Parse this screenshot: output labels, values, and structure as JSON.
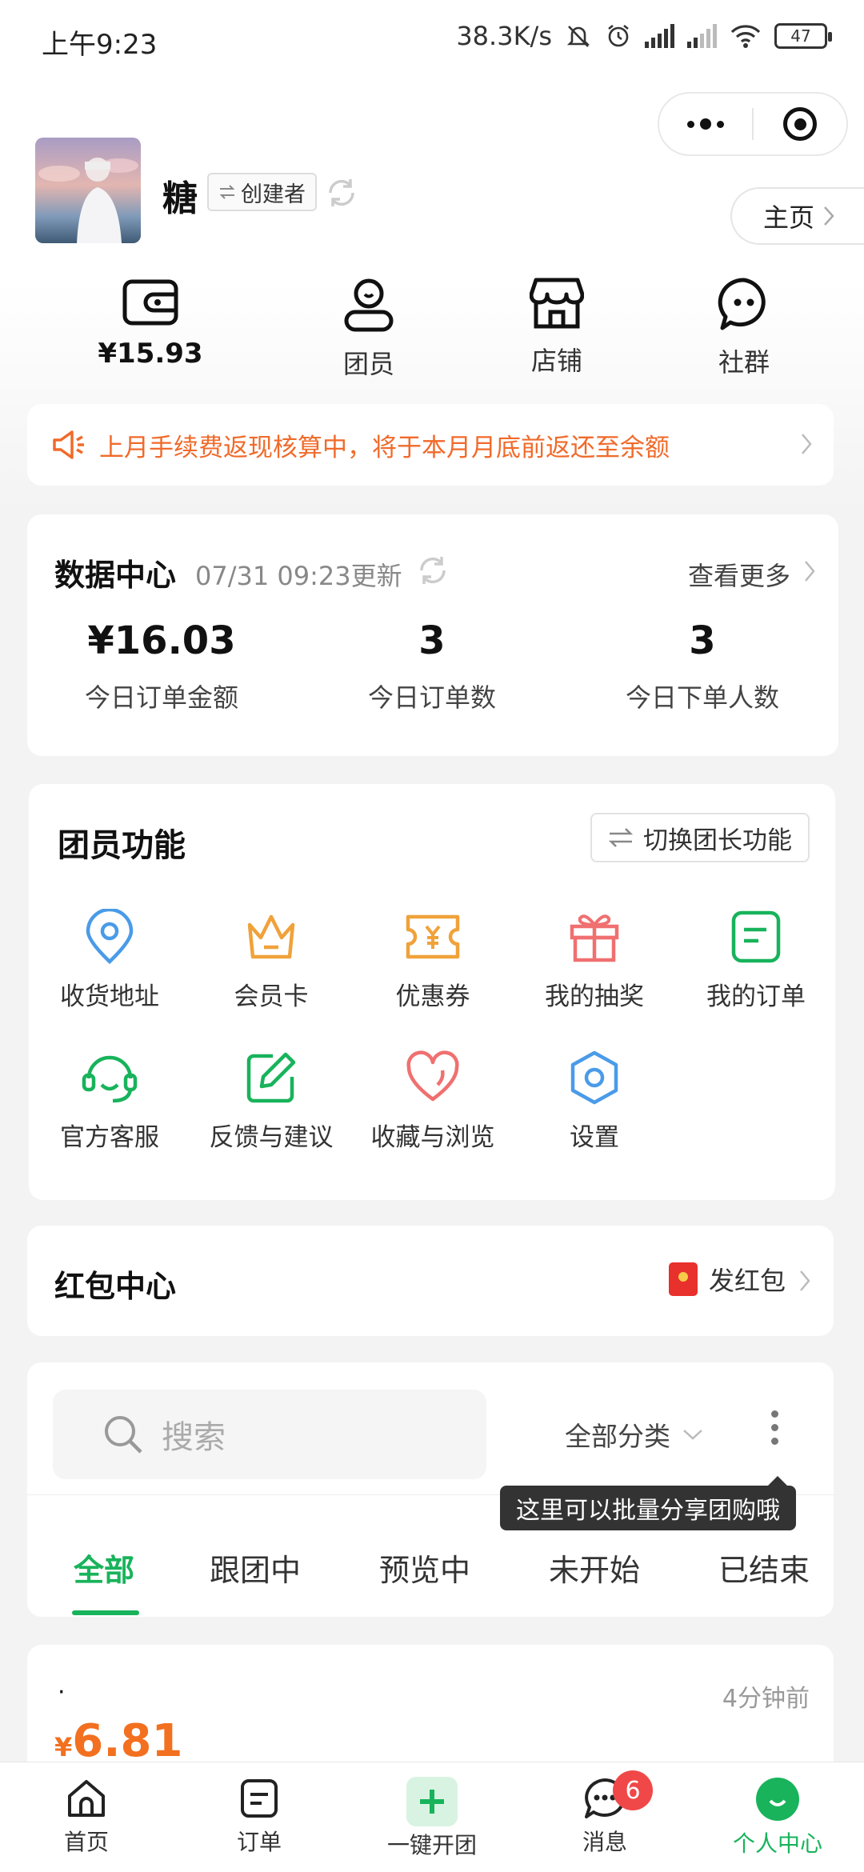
{
  "status_bar": {
    "time": "上午9:23",
    "network_speed": "38.3K/s",
    "battery": "47"
  },
  "profile": {
    "username": "糖",
    "role_tag": "创建者",
    "home_button": "主页"
  },
  "quick_row": [
    {
      "label": "¥15.93",
      "icon": "wallet-icon"
    },
    {
      "label": "团员",
      "icon": "user-icon"
    },
    {
      "label": "店铺",
      "icon": "store-icon"
    },
    {
      "label": "社群",
      "icon": "chat-bubble-icon"
    }
  ],
  "notice": {
    "text": "上月手续费返现核算中，将于本月月底前返还至余额"
  },
  "data_center": {
    "title": "数据中心",
    "updated": "07/31 09:23更新",
    "more": "查看更多",
    "stats": [
      {
        "value": "¥16.03",
        "label": "今日订单金额"
      },
      {
        "value": "3",
        "label": "今日订单数"
      },
      {
        "value": "3",
        "label": "今日下单人数"
      }
    ]
  },
  "member_functions": {
    "title": "团员功能",
    "switch_label": "切换团长功能",
    "items": [
      {
        "label": "收货地址",
        "icon": "location-pin-icon",
        "color": "#4a9be8"
      },
      {
        "label": "会员卡",
        "icon": "crown-icon",
        "color": "#f0a23a"
      },
      {
        "label": "优惠券",
        "icon": "coupon-icon",
        "color": "#f0a23a"
      },
      {
        "label": "我的抽奖",
        "icon": "gift-icon",
        "color": "#f07070"
      },
      {
        "label": "我的订单",
        "icon": "order-list-icon",
        "color": "#18b35b"
      },
      {
        "label": "官方客服",
        "icon": "headset-icon",
        "color": "#18b35b"
      },
      {
        "label": "反馈与建议",
        "icon": "edit-icon",
        "color": "#18b35b"
      },
      {
        "label": "收藏与浏览",
        "icon": "heart-icon",
        "color": "#f07070"
      },
      {
        "label": "设置",
        "icon": "hexagon-settings-icon",
        "color": "#4a9be8"
      }
    ]
  },
  "red_packet": {
    "title": "红包中心",
    "action": "发红包"
  },
  "search": {
    "placeholder": "搜索",
    "category": "全部分类",
    "tooltip": "这里可以批量分享团购哦"
  },
  "tabs": [
    "全部",
    "跟团中",
    "预览中",
    "未开始",
    "已结束"
  ],
  "product": {
    "dot": "·",
    "currency": "¥",
    "price": "6.81",
    "time": "4分钟前"
  },
  "bottom_nav": [
    {
      "label": "首页",
      "icon": "home-icon"
    },
    {
      "label": "订单",
      "icon": "order-icon"
    },
    {
      "label": "一键开团",
      "icon": "plus-icon"
    },
    {
      "label": "消息",
      "icon": "message-icon",
      "badge": "6"
    },
    {
      "label": "个人中心",
      "icon": "profile-smile-icon"
    }
  ],
  "colors": {
    "accent": "#18b35b",
    "notice": "#f06a2a",
    "price": "#f2701f",
    "badge": "#f04848"
  }
}
